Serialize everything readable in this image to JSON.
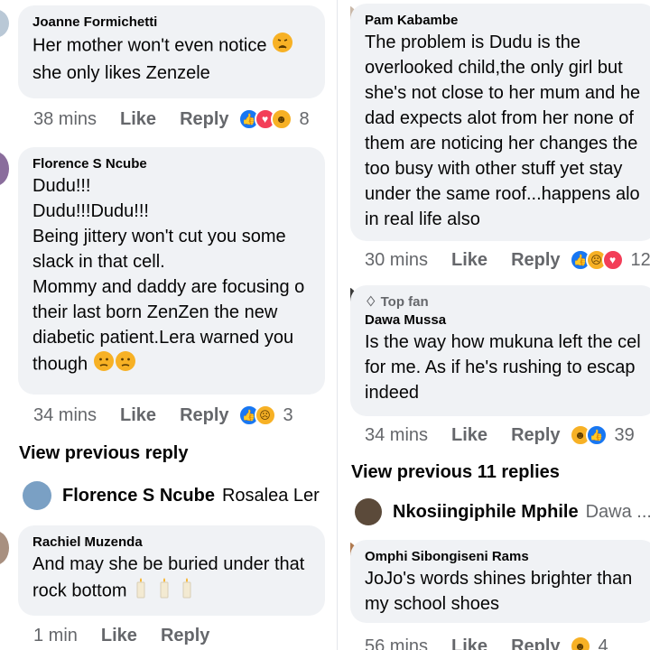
{
  "left": {
    "comment1": {
      "author": "Joanne Formichetti",
      "lines": [
        "Her mother won't even notice",
        "she only likes Zenzele"
      ],
      "time": "38 mins",
      "like": "Like",
      "reply": "Reply",
      "reaction_count": "8"
    },
    "comment2": {
      "author": "Florence S Ncube",
      "lines": [
        "Dudu!!!",
        "Dudu!!!Dudu!!!",
        "Being jittery won't cut you some",
        "slack in that cell.",
        "Mommy and daddy are focusing o",
        "their last born ZenZen the new",
        "diabetic patient.Lera warned you",
        "though"
      ],
      "time": "34 mins",
      "like": "Like",
      "reply": "Reply",
      "reaction_count": "3"
    },
    "view_previous": "View previous reply",
    "reply_preview": {
      "author": "Florence S Ncube",
      "text": "Rosalea Ler"
    },
    "comment3": {
      "author": "Rachiel Muzenda",
      "lines": [
        "And may she be buried under that",
        "rock bottom"
      ],
      "time": "1 min",
      "like": "Like",
      "reply": "Reply"
    }
  },
  "right": {
    "comment1": {
      "author": "Pam Kabambe",
      "lines": [
        "The problem is Dudu is the",
        "overlooked child,the only girl but",
        "she's not close to her mum and he",
        "dad expects alot from her none of",
        "them are noticing her changes the",
        "too busy with other stuff yet stay",
        "under the same roof...happens alo",
        "in real life also"
      ],
      "time": "30 mins",
      "like": "Like",
      "reply": "Reply",
      "reaction_count": "12"
    },
    "comment2": {
      "badge": "Top fan",
      "author": "Dawa Mussa",
      "lines": [
        "Is the way how mukuna left the cel",
        "for me. As if he's rushing to escap",
        "indeed"
      ],
      "time": "34 mins",
      "like": "Like",
      "reply": "Reply",
      "reaction_count": "39"
    },
    "view_previous": "View previous 11 replies",
    "reply_preview": {
      "author": "Nkosiingiphile Mphile",
      "text": "Dawa ..."
    },
    "comment3": {
      "author": "Omphi Sibongiseni Rams",
      "lines": [
        "JoJo's words shines brighter than",
        "my school shoes"
      ],
      "time": "56 mins",
      "like": "Like",
      "reply": "Reply",
      "reaction_count": "4"
    }
  },
  "colors": {
    "bubble": "#f0f2f5",
    "meta": "#65676b",
    "like_blue": "#1877f2",
    "love_red": "#f33e58",
    "sad_yellow": "#f7b125"
  }
}
